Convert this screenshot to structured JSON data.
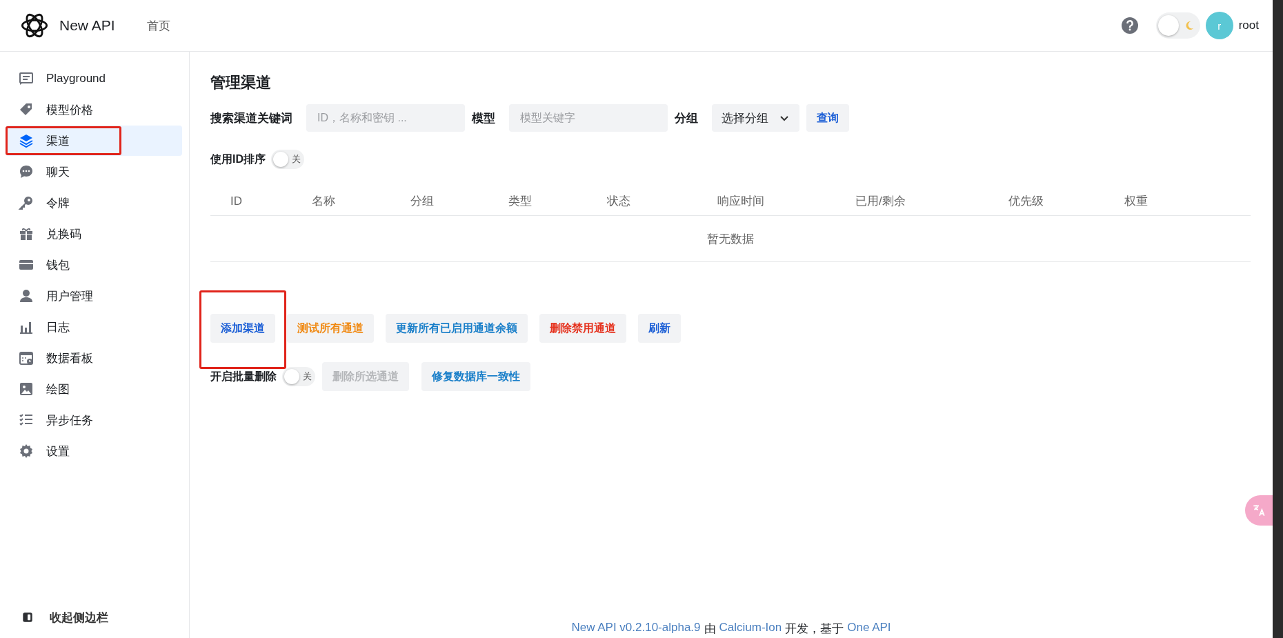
{
  "header": {
    "brand": "New API",
    "nav": [
      {
        "label": "首页",
        "selected": false
      }
    ],
    "theme_dark": false,
    "user": {
      "initial": "r",
      "name": "root"
    }
  },
  "sidebar": {
    "items": [
      {
        "label": "Playground",
        "selected": false,
        "highlighted": false
      },
      {
        "label": "模型价格",
        "selected": false,
        "highlighted": false
      },
      {
        "label": "渠道",
        "selected": true,
        "highlighted": true
      },
      {
        "label": "聊天",
        "selected": false,
        "highlighted": false
      },
      {
        "label": "令牌",
        "selected": false,
        "highlighted": false
      },
      {
        "label": "兑换码",
        "selected": false,
        "highlighted": false
      },
      {
        "label": "钱包",
        "selected": false,
        "highlighted": false
      },
      {
        "label": "用户管理",
        "selected": false,
        "highlighted": false
      },
      {
        "label": "日志",
        "selected": false,
        "highlighted": false
      },
      {
        "label": "数据看板",
        "selected": false,
        "highlighted": false
      },
      {
        "label": "绘图",
        "selected": false,
        "highlighted": false
      },
      {
        "label": "异步任务",
        "selected": false,
        "highlighted": false
      },
      {
        "label": "设置",
        "selected": false,
        "highlighted": false
      }
    ],
    "collapse": "收起侧边栏"
  },
  "page": {
    "title": "管理渠道",
    "filters": [
      {
        "kind": "input",
        "label": "搜索渠道关键词",
        "placeholder": "ID，名称和密钥 ..."
      },
      {
        "kind": "input",
        "label": "模型",
        "placeholder": "模型关键字"
      },
      {
        "kind": "select",
        "label": "分组",
        "value": "选择分组"
      }
    ],
    "query_button": "查询",
    "sort_toggle": {
      "label": "使用ID排序",
      "on": false,
      "state_text": "关"
    },
    "table": {
      "columns": [
        "ID",
        "名称",
        "分组",
        "类型",
        "状态",
        "响应时间",
        "已用/剩余",
        "优先级",
        "权重"
      ],
      "empty_text": "暂无数据"
    },
    "actions": [
      {
        "label": "添加渠道",
        "color": "#1c5fd6",
        "disabled": false,
        "highlighted": true
      },
      {
        "label": "测试所有通道",
        "color": "#f08a14",
        "disabled": false,
        "highlighted": false
      },
      {
        "label": "更新所有已启用通道余额",
        "color": "#1a7fc9",
        "disabled": false,
        "highlighted": false
      },
      {
        "label": "删除禁用通道",
        "color": "#e5331f",
        "disabled": false,
        "highlighted": false
      },
      {
        "label": "刷新",
        "color": "#1c5fd6",
        "disabled": false,
        "highlighted": false
      }
    ],
    "batch_toggle": {
      "label": "开启批量删除",
      "on": false,
      "state_text": "关"
    },
    "batch_actions": [
      {
        "label": "删除所选通道",
        "disabled": true,
        "highlighted": false
      },
      {
        "label": "修复数据库一致性",
        "color": "#1a7fc9",
        "disabled": false,
        "highlighted": false
      }
    ]
  },
  "footer": [
    {
      "text": "New API v0.2.10-alpha.9",
      "link": true
    },
    {
      "text": "由",
      "link": false
    },
    {
      "text": "Calcium-Ion",
      "link": true
    },
    {
      "text": "开发，基于",
      "link": false
    },
    {
      "text": "One API",
      "link": true
    }
  ]
}
